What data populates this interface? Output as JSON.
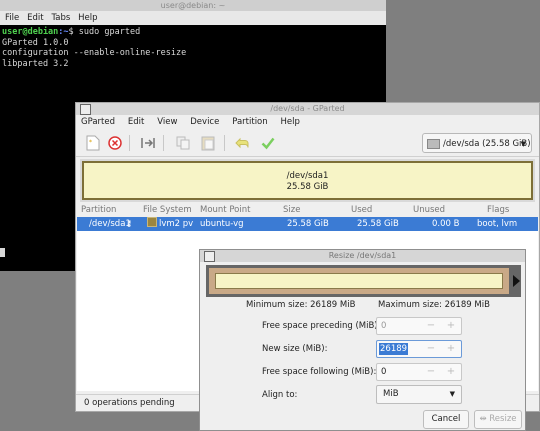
{
  "terminal": {
    "title": "user@debian: ~",
    "menu": [
      "File",
      "Edit",
      "Tabs",
      "Help"
    ],
    "lines": [
      {
        "user": "user@debian",
        "path": ":~",
        "cmd": "$ sudo gparted"
      },
      {
        "text": "GParted 1.0.0"
      },
      {
        "text": "configuration --enable-online-resize"
      },
      {
        "text": "libparted 3.2"
      }
    ]
  },
  "gparted": {
    "title": "/dev/sda - GParted",
    "menu": [
      "GParted",
      "Edit",
      "View",
      "Device",
      "Partition",
      "Help"
    ],
    "toolbar_icons": [
      "new-icon",
      "delete-icon",
      "resize-icon",
      "copy-icon",
      "paste-icon",
      "undo-icon",
      "apply-icon"
    ],
    "device": "/dev/sda (25.58 GiB)",
    "partition_map": {
      "name": "/dev/sda1",
      "size": "25.58 GiB"
    },
    "columns": [
      "Partition",
      "File System",
      "Mount Point",
      "Size",
      "Used",
      "Unused",
      "Flags"
    ],
    "rows": [
      {
        "partition": "/dev/sda1",
        "filesystem": "lvm2 pv",
        "mount": "ubuntu-vg",
        "size": "25.58 GiB",
        "used": "25.58 GiB",
        "unused": "0.00 B",
        "flags": "boot, lvm"
      }
    ],
    "status": "0 operations pending"
  },
  "dialog": {
    "title": "Resize /dev/sda1",
    "min_size": "Minimum size: 26189 MiB",
    "max_size": "Maximum size: 26189 MiB",
    "fields": {
      "preceding_label": "Free space preceding (MiB):",
      "preceding_value": "0",
      "newsize_label": "New size (MiB):",
      "newsize_value": "26189",
      "following_label": "Free space following (MiB):",
      "following_value": "0",
      "align_label": "Align to:",
      "align_value": "MiB"
    },
    "buttons": {
      "cancel": "Cancel",
      "resize": "Resize"
    }
  }
}
